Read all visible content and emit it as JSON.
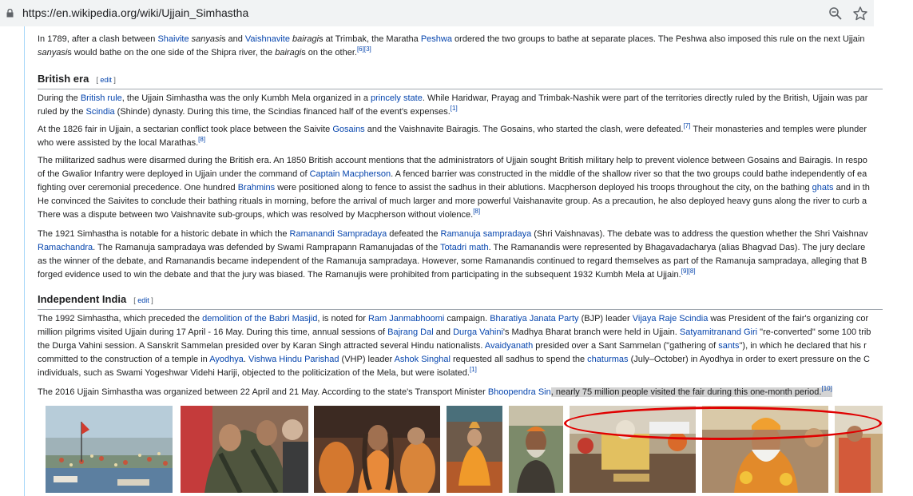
{
  "browser": {
    "url": "https://en.wikipedia.org/wiki/Ujjain_Simhastha",
    "icons": [
      "lock-icon",
      "zoom-icon",
      "star-icon"
    ]
  },
  "intro_para": {
    "t1": "In 1789, after a clash between ",
    "l1": "Shaivite",
    "t2": " ",
    "i1": "sanyasi",
    "t3": "s and ",
    "l2": "Vaishnavite",
    "t4": " ",
    "i2": "bairagi",
    "t5": "s at Trimbak, the Maratha ",
    "l3": "Peshwa",
    "t6": " ordered the two groups to bathe at separate places. The Peshwa also imposed this rule on the next Ujjain",
    "i3": "sanyasi",
    "t7": "s would bathe on the one side of the Shipra river, the ",
    "i4": "bairagi",
    "t8": "s on the other.",
    "c1": "[6]",
    "c2": "[3]"
  },
  "british": {
    "heading": "British era",
    "edit_open": "[ ",
    "edit_label": "edit",
    "edit_close": " ]",
    "p1": {
      "t1": "During the ",
      "l1": "British rule",
      "t2": ", the Ujjain Simhastha was the only Kumbh Mela organized in a ",
      "l2": "princely state",
      "t3": ". While Haridwar, Prayag and Trimbak-Nashik were part of the territories directly ruled by the British, Ujjain was par",
      "t4": "ruled by the ",
      "l3": "Scindia",
      "t5": " (Shinde) dynasty. During this time, the Scindias financed half of the event's expenses.",
      "c1": "[1]"
    },
    "p2": {
      "t1": "At the 1826 fair in Ujjain, a sectarian conflict took place between the Saivite ",
      "l1": "Gosains",
      "t2": " and the Vaishnavite Bairagis. The Gosains, who started the clash, were defeated.",
      "c1": "[7]",
      "t3": " Their monasteries and temples were plunder",
      "t4": "who were assisted by the local Marathas.",
      "c2": "[8]"
    },
    "p3": {
      "t1": "The militarized sadhus were disarmed during the British era. An 1850 British account mentions that the administrators of Ujjain sought British military help to prevent violence between Gosains and Bairagis. In respo",
      "t2": "of the Gwalior Infantry were deployed in Ujjain under the command of ",
      "l1": "Captain Macpherson",
      "t3": ". A fenced barrier was constructed in the middle of the shallow river so that the two groups could bathe independently of ea",
      "t4": "fighting over ceremonial precedence. One hundred ",
      "l2": "Brahmins",
      "t5": " were positioned along to fence to assist the sadhus in their ablutions. Macpherson deployed his troops throughout the city, on the bathing ",
      "l3": "ghats",
      "t6": " and in th",
      "t7": "He convinced the Saivites to conclude their bathing rituals in morning, before the arrival of much larger and more powerful Vaishanavite group. As a precaution, he also deployed heavy guns along the river to curb a",
      "t8": "There was a dispute between two Vaishnavite sub-groups, which was resolved by Macpherson without violence.",
      "c1": "[8]"
    },
    "p4": {
      "t1": "The 1921 Simhastha is notable for a historic debate in which the ",
      "l1": "Ramanandi Sampradaya",
      "t2": " defeated the ",
      "l2": "Ramanuja sampradaya",
      "t3": " (Shri Vaishnavas). The debate was to address the question whether the Shri Vaishnav",
      "l3": "Ramachandra",
      "t4": ". The Ramanuja sampradaya was defended by Swami Ramprapann Ramanujadas of the ",
      "l4": "Totadri math",
      "t5": ". The Ramanandis were represented by Bhagavadacharya (alias Bhagvad Das). The jury declare",
      "t6": "as the winner of the debate, and Ramanandis became independent of the Ramanuja sampradaya. However, some Ramanandis continued to regard themselves as part of the Ramanuja sampradaya, alleging that B",
      "t7": "forged evidence used to win the debate and that the jury was biased. The Ramanujis were prohibited from participating in the subsequent 1932 Kumbh Mela at Ujjain.",
      "c1": "[9]",
      "c2": "[8]"
    }
  },
  "independent": {
    "heading": "Independent India",
    "edit_open": "[ ",
    "edit_label": "edit",
    "edit_close": " ]",
    "p1": {
      "t1": "The 1992 Simhastha, which preceded the ",
      "l1": "demolition of the Babri Masjid",
      "t2": ", is noted for ",
      "l2": "Ram Janmabhoomi",
      "t3": " campaign. ",
      "l3": "Bharatiya Janata Party",
      "t4": " (BJP) leader ",
      "l4": "Vijaya Raje Scindia",
      "t5": " was President of the fair's organizing cor",
      "t6": "million pilgrims visited Ujjain during 17 April - 16 May. During this time, annual sessions of ",
      "l5": "Bajrang Dal",
      "t7": " and ",
      "l6": "Durga Vahini",
      "t8": "'s Madhya Bharat branch were held in Ujjain. ",
      "l7": "Satyamitranand Giri",
      "t9": " \"re-converted\" some 100 trib",
      "t10": "the Durga Vahini session. A Sanskrit Sammelan presided over by Karan Singh attracted several Hindu nationalists. ",
      "l8": "Avaidyanath",
      "t11": " presided over a Sant Sammelan (\"gathering of ",
      "l9": "sants",
      "t12": "\"), in which he declared that his r",
      "t13": "committed to the construction of a temple in ",
      "l10": "Ayodhya",
      "t14": ". ",
      "l11": "Vishwa Hindu Parishad",
      "t15": " (VHP) leader ",
      "l12": "Ashok Singhal",
      "t16": " requested all sadhus to spend the ",
      "l13": "chaturmas",
      "t17": " (July–October) in Ayodhya in order to exert pressure on the C",
      "t18": "individuals, such as Swami Yogeshwar Videhi Hariji, objected to the politicization of the Mela, but were isolated.",
      "c1": "[1]"
    },
    "p2": {
      "t1": "The 2016 Ujjain Simhastha was organized between 22 April and 21 May. According to the state's Transport Minister ",
      "l1": "Bhoopendra Sin",
      "t2": ", nearly 75 million people visited the fair during this one-month period.",
      "c1": "[10]"
    }
  }
}
